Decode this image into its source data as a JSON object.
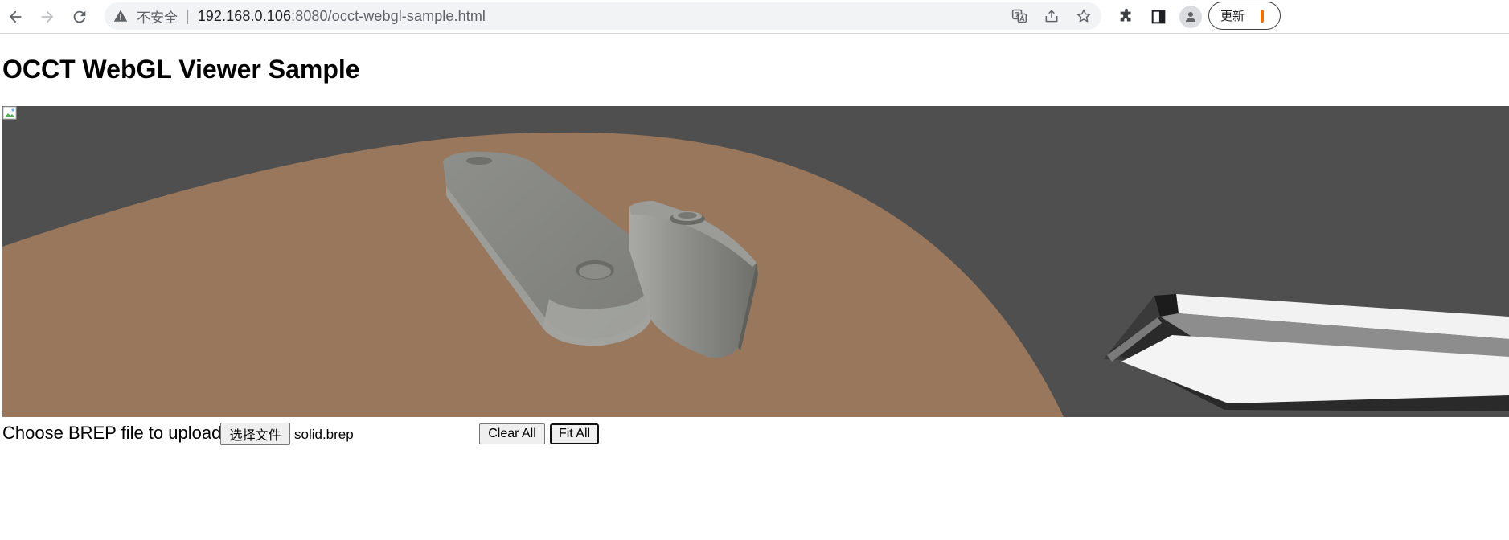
{
  "browser": {
    "security_label": "不安全",
    "url_host": "192.168.0.106",
    "url_rest": ":8080/occt-webgl-sample.html",
    "update_label": "更新",
    "accent_update": "#e8710a"
  },
  "page": {
    "title": "OCCT WebGL Viewer Sample"
  },
  "viewer": {
    "background": "#4f4f4f",
    "ground_color": "#98775c",
    "model_color": "#8f908c",
    "navcube_color": "#f0f0f0"
  },
  "controls": {
    "upload_label": "Choose BREP file to upload:",
    "file_button_label": "选择文件",
    "file_name": "solid.brep",
    "clear_all_label": "Clear All",
    "fit_all_label": "Fit All"
  }
}
